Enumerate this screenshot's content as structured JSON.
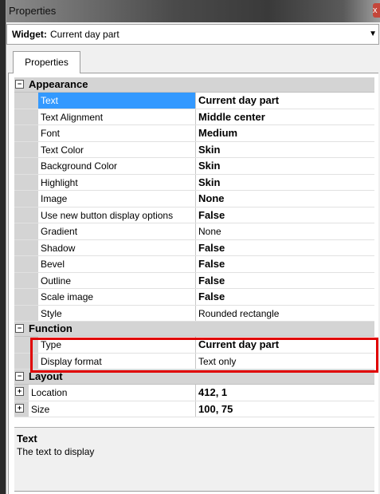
{
  "window": {
    "title": "Properties",
    "close_glyph": "x"
  },
  "widget": {
    "label": "Widget:",
    "value": "Current day part",
    "dropdown_icon": "triangle-down"
  },
  "tabs": [
    {
      "label": "Properties"
    }
  ],
  "categories": [
    {
      "label": "Appearance",
      "toggle": "⊟",
      "rows": [
        {
          "name": "Text",
          "value": "Current day part",
          "bold": true
        },
        {
          "name": "Text Alignment",
          "value": "Middle center",
          "bold": true
        },
        {
          "name": "Font",
          "value": "Medium",
          "bold": true
        },
        {
          "name": "Text Color",
          "value": "Skin",
          "bold": true
        },
        {
          "name": "Background Color",
          "value": "Skin",
          "bold": true
        },
        {
          "name": "Highlight",
          "value": "Skin",
          "bold": true
        },
        {
          "name": "Image",
          "value": "None",
          "bold": true
        },
        {
          "name": "Use new button display options",
          "value": "False",
          "bold": true
        },
        {
          "name": "Gradient",
          "value": "None",
          "bold": false
        },
        {
          "name": "Shadow",
          "value": "False",
          "bold": true
        },
        {
          "name": "Bevel",
          "value": "False",
          "bold": true
        },
        {
          "name": "Outline",
          "value": "False",
          "bold": true
        },
        {
          "name": "Scale image",
          "value": "False",
          "bold": true
        },
        {
          "name": "Style",
          "value": "Rounded rectangle",
          "bold": false
        }
      ]
    },
    {
      "label": "Function",
      "toggle": "⊟",
      "rows": [
        {
          "name": "Type",
          "value": "Current day part",
          "bold": true
        },
        {
          "name": "Display format",
          "value": "Text only",
          "bold": false
        }
      ]
    },
    {
      "label": "Layout",
      "toggle": "⊟",
      "rows": [
        {
          "name": "Location",
          "value": "412, 1",
          "bold": true,
          "expander": "⊞"
        },
        {
          "name": "Size",
          "value": "100, 75",
          "bold": true,
          "expander": "⊞"
        }
      ]
    }
  ],
  "selected_property": "Text",
  "description": {
    "title": "Text",
    "text": "The text to display"
  },
  "colors": {
    "selection": "#3399ff",
    "highlight_box": "#e00000",
    "category_bg": "#d4d4d4"
  }
}
